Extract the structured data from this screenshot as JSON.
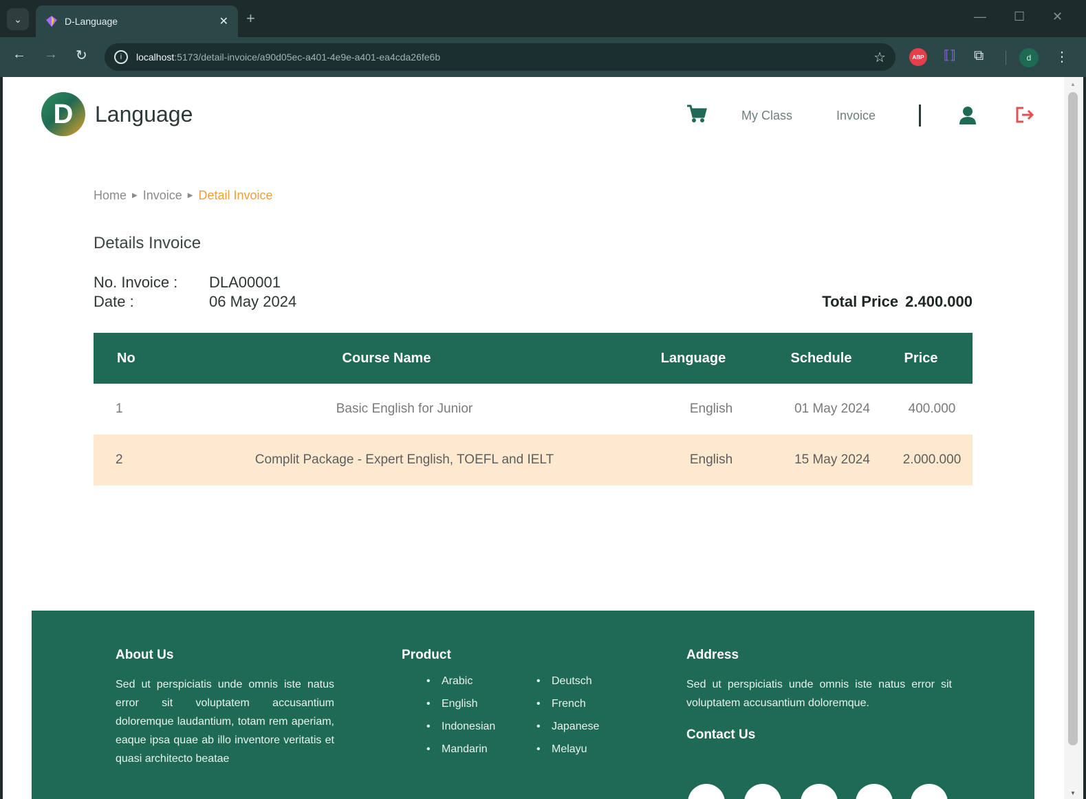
{
  "browser": {
    "tab_title": "D-Language",
    "url_host": "localhost",
    "url_rest": ":5173/detail-invoice/a90d05ec-a401-4e9e-a401-ea4cda26fe6b",
    "abp_label": "ABP",
    "profile_initial": "d"
  },
  "header": {
    "logo_letter": "D",
    "logo_text": "Language",
    "nav": {
      "my_class": "My Class",
      "invoice": "Invoice"
    }
  },
  "breadcrumb": {
    "home": "Home",
    "invoice": "Invoice",
    "current": "Detail Invoice"
  },
  "page": {
    "title": "Details Invoice",
    "invoice_no_label": "No. Invoice :",
    "invoice_no": "DLA00001",
    "date_label": "Date :",
    "date": "06 May 2024",
    "total_label": "Total Price",
    "total_value": "2.400.000"
  },
  "table": {
    "headers": [
      "No",
      "Course Name",
      "Language",
      "Schedule",
      "Price"
    ],
    "rows": [
      {
        "no": "1",
        "course": "Basic English for Junior",
        "language": "English",
        "schedule": "01 May 2024",
        "price": "400.000"
      },
      {
        "no": "2",
        "course": "Complit Package - Expert English, TOEFL and IELT",
        "language": "English",
        "schedule": "15 May 2024",
        "price": "2.000.000"
      }
    ]
  },
  "footer": {
    "about": {
      "title": "About Us",
      "text": "Sed ut perspiciatis unde omnis iste natus error sit voluptatem accusantium doloremque laudantium, totam rem aperiam, eaque ipsa quae ab illo inventore veritatis et quasi architecto beatae"
    },
    "product": {
      "title": "Product",
      "col1": [
        "Arabic",
        "English",
        "Indonesian",
        "Mandarin"
      ],
      "col2": [
        "Deutsch",
        "French",
        "Japanese",
        "Melayu"
      ]
    },
    "address": {
      "title": "Address",
      "text": "Sed ut perspiciatis unde omnis iste natus error sit voluptatem accusantium doloremque."
    },
    "contact_title": "Contact Us"
  },
  "colors": {
    "brand_green": "#1e6a54",
    "accent_orange": "#f0a03a",
    "row_highlight": "#fce9cf",
    "logout_red": "#e25050"
  }
}
